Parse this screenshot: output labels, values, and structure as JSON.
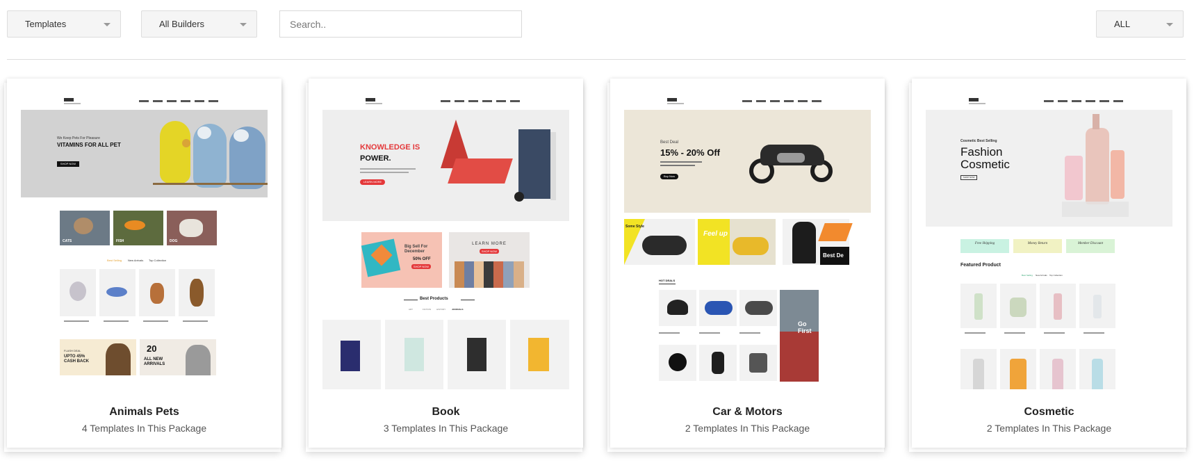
{
  "toolbar": {
    "type_filter": "Templates",
    "builder_filter": "All Builders",
    "search_placeholder": "Search..",
    "category_filter": "ALL"
  },
  "cards": [
    {
      "title": "Animals Pets",
      "subtitle": "4 Templates In This Package",
      "preview": {
        "hero_small": "We Keep Pets For Pleasure",
        "hero_title": "VITAMINS FOR ALL PET",
        "hero_button": "SHOP NOW",
        "categories": [
          "CATS",
          "FISH",
          "DOG"
        ],
        "tabs": [
          "Best Selling",
          "New Arrivals",
          "Top Collection"
        ],
        "banner_left": "UPTO 45% CASH BACK",
        "banner_left_small": "FLASH DEAL",
        "banner_right_num": "20",
        "banner_right": "ALL NEW ARRIVALS"
      }
    },
    {
      "title": "Book",
      "subtitle": "3 Templates In This Package",
      "preview": {
        "hero_title_1": "KNOWLEDGE IS",
        "hero_title_2": "POWER.",
        "hero_button": "LEARN MORE",
        "promo_left": "Big Sell For December",
        "promo_left_badge": "50% OFF",
        "promo_left_button": "SHOP NOW",
        "promo_right": "LEARN MORE",
        "promo_right_button": "SHOP NOW",
        "section_title": "Best Products",
        "tabs": [
          "ART",
          "FICTION",
          "HISTORY",
          "JOURNALS"
        ]
      }
    },
    {
      "title": "Car & Motors",
      "subtitle": "2 Templates In This Package",
      "preview": {
        "hero_small": "Best Deal",
        "hero_title": "15% - 20% Off",
        "hero_button": "Buy Now",
        "tile_1": "Some Style",
        "tile_2": "Feel up",
        "tile_3": "Best De",
        "section_title": "HOT DEALS",
        "side_banner": "Go First"
      }
    },
    {
      "title": "Cosmetic",
      "subtitle": "2 Templates In This Package",
      "preview": {
        "hero_small": "Cosmetic Best Selling",
        "hero_title_1": "Fashion",
        "hero_title_2": "Cosmetic",
        "hero_button": "SHOP NOW",
        "pills": [
          "Free Shipping",
          "Money Return",
          "Member Discount"
        ],
        "section_title": "Featured Product",
        "tabs": [
          "Best Selling",
          "New Arrivals",
          "Top Collection"
        ]
      }
    }
  ]
}
